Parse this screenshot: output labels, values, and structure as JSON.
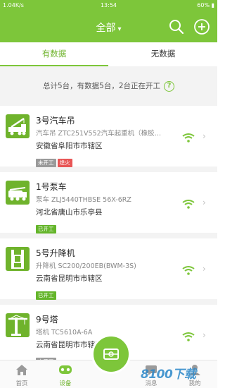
{
  "status_bar": {
    "left": "1.04K/s",
    "time": "13:54",
    "battery": "60%"
  },
  "header": {
    "title": "全部",
    "search_icon": "search-icon",
    "add_icon": "plus-circle-icon"
  },
  "tabs": [
    {
      "label": "有数据",
      "active": true
    },
    {
      "label": "无数据",
      "active": false
    }
  ],
  "summary": {
    "text": "总计5台，有数据5台，2台正在开工",
    "help": "?"
  },
  "devices": [
    {
      "name": "3号汽车吊",
      "model": "汽车吊 ZTC251V552汽车起重机（橡胶…",
      "location": "安徽省阜阳市市辖区",
      "icon": "crane-truck-icon",
      "badges": [
        {
          "text": "未开工",
          "style": "gray"
        },
        {
          "text": "熄火",
          "style": "red"
        }
      ]
    },
    {
      "name": "1号泵车",
      "model": "泵车 ZLJ5440THBSE 56X-6RZ",
      "location": "河北省唐山市乐亭县",
      "icon": "pump-truck-icon",
      "badges": [
        {
          "text": "已开工",
          "style": "green"
        }
      ]
    },
    {
      "name": "5号升降机",
      "model": "升降机 SC200/200EB(BWM-3S)",
      "location": "云南省昆明市市辖区",
      "icon": "elevator-icon",
      "badges": [
        {
          "text": "已开工",
          "style": "green"
        }
      ]
    },
    {
      "name": "9号塔",
      "model": "塔机 TC5610A-6A",
      "location": "云南省昆明市市辖区",
      "icon": "tower-crane-icon",
      "badges": [
        {
          "text": "未开工",
          "style": "gray"
        }
      ]
    }
  ],
  "bottom_nav": [
    {
      "label": "首页",
      "icon": "home-icon",
      "active": false
    },
    {
      "label": "设备",
      "icon": "device-icon",
      "active": true
    },
    {
      "label": "消息",
      "icon": "message-icon",
      "active": false
    },
    {
      "label": "我的",
      "icon": "profile-icon",
      "active": false
    }
  ],
  "watermark": "8100下载",
  "colors": {
    "brand": "#7dc63a",
    "active_text": "#6fb32c",
    "badge_gray": "#9a9a9a",
    "badge_red": "#e85555",
    "badge_green": "#64b52a"
  }
}
